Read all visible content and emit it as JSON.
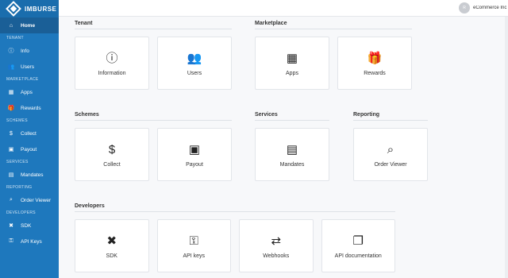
{
  "brand": {
    "name": "IMBURSE"
  },
  "user": {
    "initial": "R",
    "tenant": "eCommerce Inc"
  },
  "sidebar": {
    "home": {
      "label": "Home",
      "icon": "home-icon"
    },
    "sections": [
      {
        "title": "TENANT",
        "items": [
          {
            "label": "Info",
            "icon": "info-icon"
          },
          {
            "label": "Users",
            "icon": "users-icon"
          }
        ]
      },
      {
        "title": "MARKETPLACE",
        "items": [
          {
            "label": "Apps",
            "icon": "apps-icon"
          },
          {
            "label": "Rewards",
            "icon": "gift-icon"
          }
        ]
      },
      {
        "title": "SCHEMES",
        "items": [
          {
            "label": "Collect",
            "icon": "collect-icon"
          },
          {
            "label": "Payout",
            "icon": "payout-icon"
          }
        ]
      },
      {
        "title": "SERVICES",
        "items": [
          {
            "label": "Mandates",
            "icon": "document-icon"
          }
        ]
      },
      {
        "title": "REPORTING",
        "items": [
          {
            "label": "Order Viewer",
            "icon": "search-icon"
          }
        ]
      },
      {
        "title": "DEVELOPERS",
        "items": [
          {
            "label": "SDK",
            "icon": "tools-icon"
          },
          {
            "label": "API Keys",
            "icon": "key-icon"
          }
        ]
      }
    ]
  },
  "main": {
    "tenant": {
      "title": "Tenant",
      "cards": [
        {
          "label": "Information",
          "icon": "info-icon"
        },
        {
          "label": "Users",
          "icon": "users-icon"
        }
      ]
    },
    "marketplace": {
      "title": "Marketplace",
      "cards": [
        {
          "label": "Apps",
          "icon": "apps-icon"
        },
        {
          "label": "Rewards",
          "icon": "gift-icon"
        }
      ]
    },
    "schemes": {
      "title": "Schemes",
      "cards": [
        {
          "label": "Collect",
          "icon": "collect-icon"
        },
        {
          "label": "Payout",
          "icon": "payout-icon"
        }
      ]
    },
    "services": {
      "title": "Services",
      "cards": [
        {
          "label": "Mandates",
          "icon": "document-icon"
        }
      ]
    },
    "reporting": {
      "title": "Reporting",
      "cards": [
        {
          "label": "Order Viewer",
          "icon": "search-icon"
        }
      ]
    },
    "developers": {
      "title": "Developers",
      "cards": [
        {
          "label": "SDK",
          "icon": "tools-icon"
        },
        {
          "label": "API keys",
          "icon": "key-icon"
        },
        {
          "label": "Webhooks",
          "icon": "shuffle-icon"
        },
        {
          "label": "API documentation",
          "icon": "files-icon"
        }
      ]
    }
  },
  "colors": {
    "sidebar": "#1e78bd",
    "sidebar_active": "#1a5f97",
    "background": "#f7f8fa"
  }
}
